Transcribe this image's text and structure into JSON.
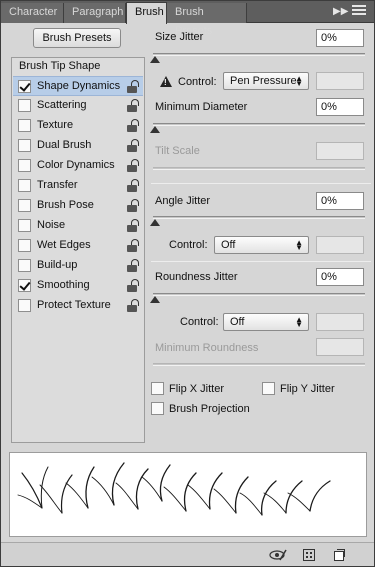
{
  "tabs": [
    {
      "label": "Character"
    },
    {
      "label": "Paragraph"
    },
    {
      "label": "Brush",
      "active": true
    },
    {
      "label": "Brush Presets"
    }
  ],
  "tab_controls": {
    "collapse_icon": "double-chevron-right",
    "menu_icon": "panel-menu"
  },
  "brush_presets_button": "Brush Presets",
  "left": {
    "title": "Brush Tip Shape",
    "options": [
      {
        "label": "Shape Dynamics",
        "checked": true,
        "selected": true,
        "locked": false
      },
      {
        "label": "Scattering",
        "checked": false,
        "locked": false
      },
      {
        "label": "Texture",
        "checked": false,
        "locked": false
      },
      {
        "label": "Dual Brush",
        "checked": false,
        "locked": false
      },
      {
        "label": "Color Dynamics",
        "checked": false,
        "locked": false
      },
      {
        "label": "Transfer",
        "checked": false,
        "locked": false
      },
      {
        "label": "Brush Pose",
        "checked": false,
        "locked": false
      },
      {
        "label": "Noise",
        "checked": false,
        "locked": false
      },
      {
        "label": "Wet Edges",
        "checked": false,
        "locked": false
      },
      {
        "label": "Build-up",
        "checked": false,
        "locked": false
      },
      {
        "label": "Smoothing",
        "checked": true,
        "locked": false
      },
      {
        "label": "Protect Texture",
        "checked": false,
        "locked": false
      }
    ]
  },
  "right": {
    "size_jitter": {
      "label": "Size Jitter",
      "value": "0%",
      "slider_fraction": 0
    },
    "size_control": {
      "label": "Control:",
      "value": "Pen Pressure",
      "warning_icon": "warning-icon"
    },
    "minimum_diameter": {
      "label": "Minimum Diameter",
      "value": "0%",
      "slider_fraction": 0
    },
    "tilt_scale": {
      "label": "Tilt Scale",
      "value": ""
    },
    "angle_jitter": {
      "label": "Angle Jitter",
      "value": "0%",
      "slider_fraction": 0
    },
    "angle_control": {
      "label": "Control:",
      "value": "Off"
    },
    "roundness_jitter": {
      "label": "Roundness Jitter",
      "value": "0%",
      "slider_fraction": 0
    },
    "roundness_control": {
      "label": "Control:",
      "value": "Off"
    },
    "minimum_roundness": {
      "label": "Minimum Roundness",
      "value": ""
    },
    "flip_x": {
      "label": "Flip X Jitter",
      "checked": false
    },
    "flip_y": {
      "label": "Flip Y Jitter",
      "checked": false
    },
    "brush_projection": {
      "label": "Brush Projection",
      "checked": false
    }
  },
  "footer_icons": [
    "eye-brush-icon",
    "grid-icon",
    "new-preset-icon"
  ]
}
